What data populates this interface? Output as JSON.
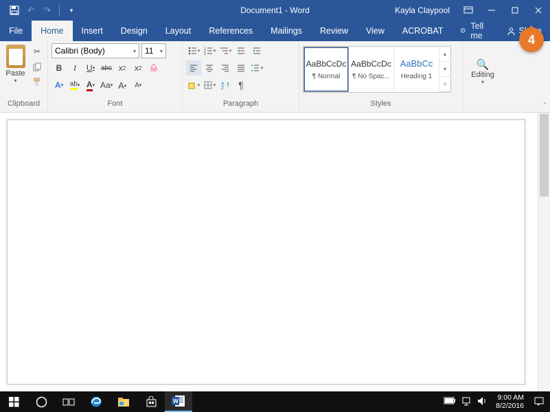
{
  "title": "Document1 - Word",
  "user": "Kayla Claypool",
  "tabs": {
    "file": "File",
    "home": "Home",
    "insert": "Insert",
    "design": "Design",
    "layout": "Layout",
    "references": "References",
    "mailings": "Mailings",
    "review": "Review",
    "view": "View",
    "acrobat": "ACROBAT"
  },
  "tellme": "Tell me",
  "share": "Share",
  "groups": {
    "clipboard": "Clipboard",
    "font": "Font",
    "paragraph": "Paragraph",
    "styles": "Styles",
    "editing": "Editing"
  },
  "clipboard": {
    "paste": "Paste"
  },
  "font": {
    "name": "Calibri (Body)",
    "size": "11",
    "bold": "B",
    "italic": "I",
    "underline": "U",
    "strike": "abc",
    "sub": "x",
    "sup": "x",
    "caseAa": "Aa",
    "growA": "A",
    "shrinkA": "A"
  },
  "styles": {
    "preview": "AaBbCcDc",
    "previewHeading": "AaBbCc",
    "normal": "¶ Normal",
    "nospace": "¶ No Spac...",
    "heading1": "Heading 1"
  },
  "editing": "Editing",
  "callout": "4",
  "taskbar": {
    "time": "9:00 AM",
    "date": "8/2/2016"
  }
}
